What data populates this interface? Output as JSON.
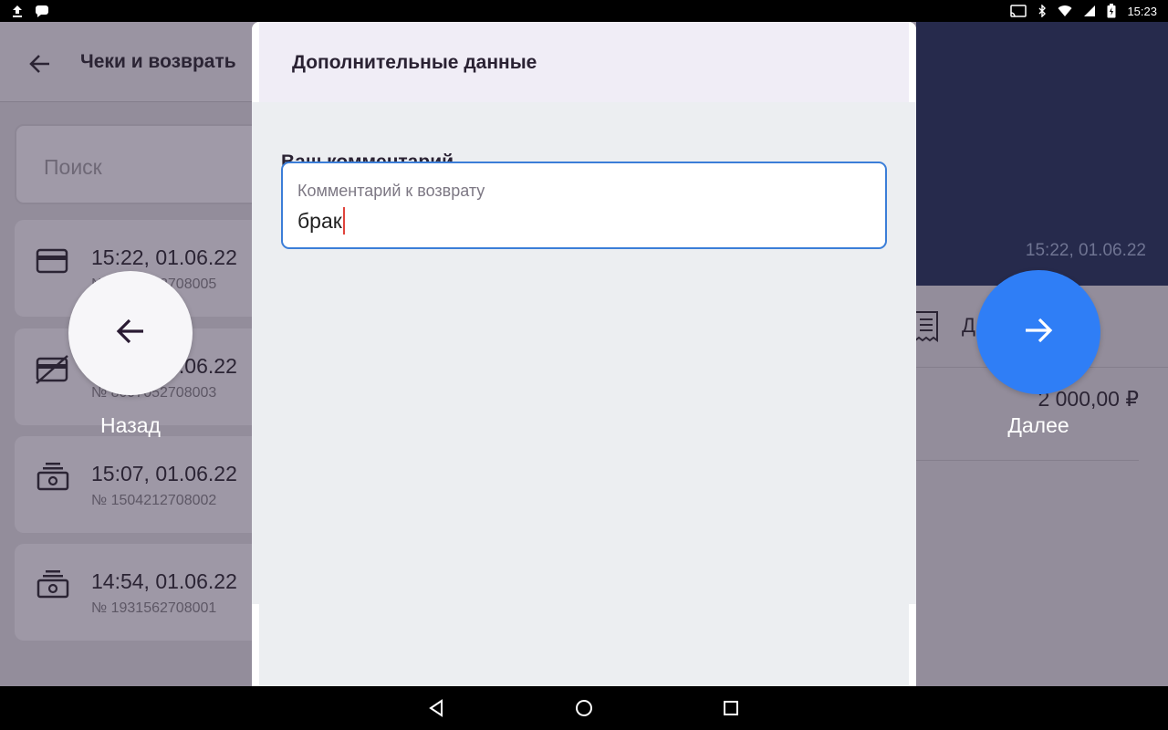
{
  "status_bar": {
    "time": "15:23"
  },
  "background": {
    "title": "Чеки и возврать",
    "search_placeholder": "Поиск",
    "receipts": [
      {
        "time": "15:22, 01.06.22",
        "number": "№ 0902712708005",
        "icon": "credit-card-icon"
      },
      {
        "time": "15:13, 01.06.22",
        "number": "№ 8097052708003",
        "icon": "card-crossed-icon"
      },
      {
        "time": "15:07, 01.06.22",
        "number": "№ 1504212708002",
        "icon": "cash-icon"
      },
      {
        "time": "14:54, 01.06.22",
        "number": "№ 1931562708001",
        "icon": "cash-icon"
      }
    ],
    "detail_date": "15:22, 01.06.22",
    "detail_label": "Д",
    "detail_amount": "2 000,00 ₽"
  },
  "modal": {
    "title": "Дополнительные данные",
    "field_label": "Ваш комментарий",
    "input_hint": "Комментарий к возврату",
    "input_value": "брак"
  },
  "actions": {
    "back_label": "Назад",
    "next_label": "Далее"
  },
  "colors": {
    "accent": "#2f7ef6",
    "input_border": "#3b7ed8",
    "caret": "#e0443c",
    "dark_panel": "#262a4c"
  }
}
